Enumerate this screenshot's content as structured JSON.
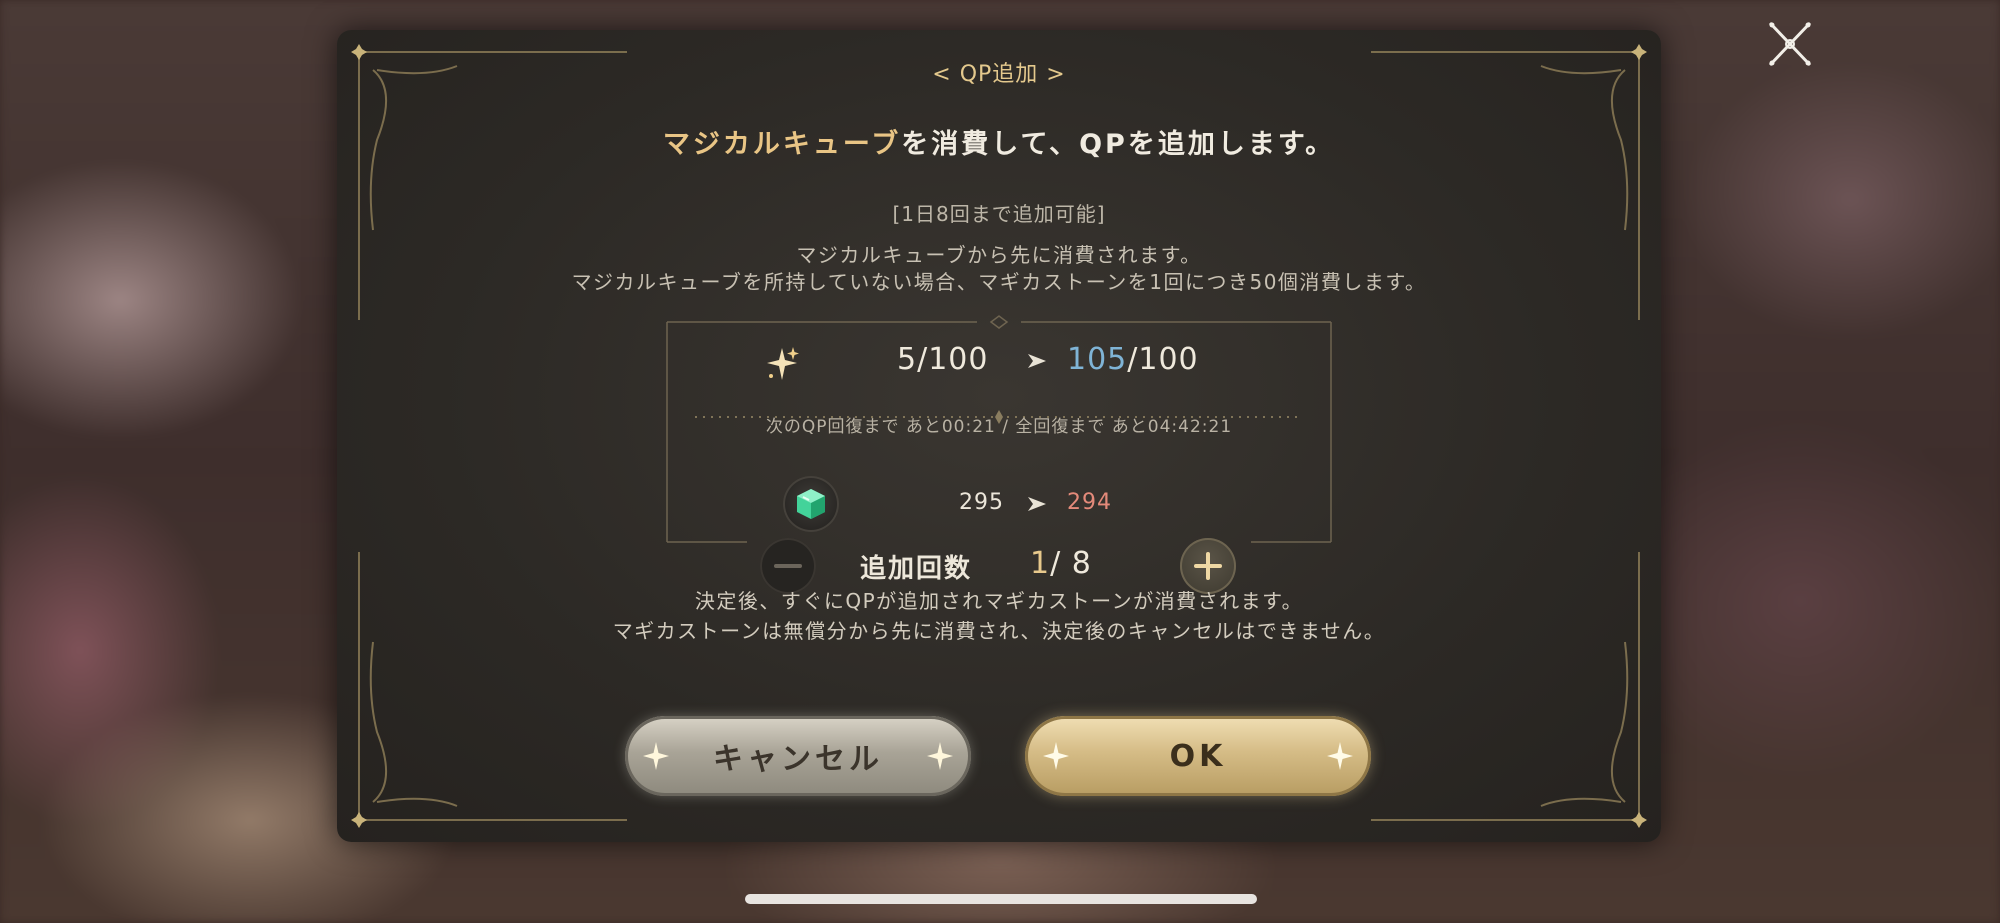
{
  "dialog": {
    "title": "< QP追加 >",
    "headline_highlight": "マジカルキューブ",
    "headline_rest": "を消費して、QPを追加します。",
    "limit_text": "[1日8回まで追加可能]",
    "desc_line1": "マジカルキューブから先に消費されます。",
    "desc_line2": "マジカルキューブを所持していない場合、マギカストーンを1回につき50個消費します。"
  },
  "qp": {
    "icon": "sparkle-icon",
    "current": "5",
    "max": "100",
    "after": "105",
    "after_max": "100",
    "separator": "/",
    "recovery_text": "次のQP回復まで あと00:21 / 全回復まで あと04:42:21"
  },
  "magica_stone": {
    "icon": "cube-icon",
    "current": "295",
    "after": "294"
  },
  "stepper": {
    "label": "追加回数",
    "current": "1",
    "max": "8",
    "separator": "/ "
  },
  "notes": {
    "line1": "決定後、すぐにQPが追加されマギカストーンが消費されます。",
    "line2": "マギカストーンは無償分から先に消費され、決定後のキャンセルはできません。"
  },
  "buttons": {
    "cancel": "キャンセル",
    "ok": "OK"
  },
  "colors": {
    "accent_gold": "#e9c585",
    "after_qp_blue": "#7fb4d6",
    "after_stone_red": "#e48a7a"
  }
}
